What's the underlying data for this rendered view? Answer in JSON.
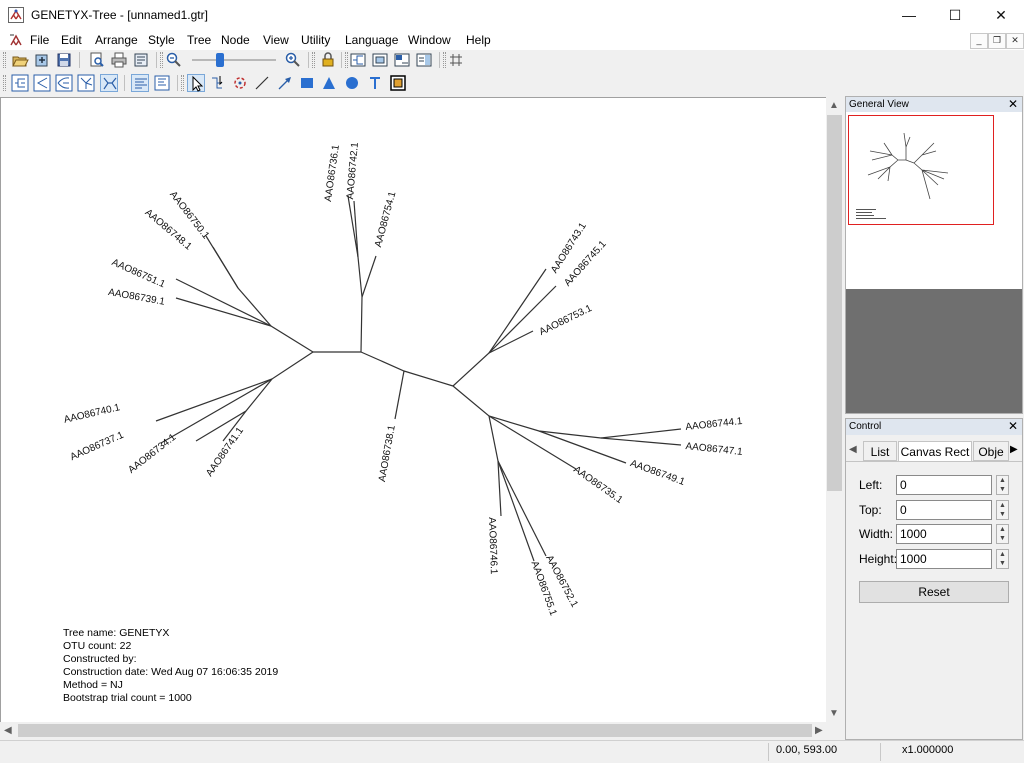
{
  "window": {
    "title": "GENETYX-Tree - [unnamed1.gtr]",
    "controls": {
      "minimize": "—",
      "maximize": "☐",
      "close": "✕"
    }
  },
  "menubar": {
    "items": [
      "File",
      "Edit",
      "Arrange",
      "Style",
      "Tree",
      "Node",
      "View",
      "Utility",
      "Language",
      "Window",
      "Help"
    ],
    "mdi_controls": {
      "minimize": "_",
      "restore": "❐",
      "close": "✕"
    }
  },
  "tree": {
    "leaves": [
      "AAO86736.1",
      "AAO86742.1",
      "AAO86754.1",
      "AAO86750.1",
      "AAO86748.1",
      "AAO86751.1",
      "AAO86739.1",
      "AAO86743.1",
      "AAO86745.1",
      "AAO86753.1",
      "AAO86744.1",
      "AAO86747.1",
      "AAO86749.1",
      "AAO86735.1",
      "AAO86740.1",
      "AAO86737.1",
      "AAO86734.1",
      "AAO86741.1",
      "AAO86738.1",
      "AAO86746.1",
      "AAO86752.1",
      "AAO86755.1"
    ],
    "info": [
      "Tree name: GENETYX",
      "OTU count: 22",
      "Constructed by:",
      "Construction date: Wed Aug 07 16:06:35 2019",
      "Method = NJ",
      "Bootstrap trial count = 1000"
    ]
  },
  "statusbar": {
    "coordinates": "0.00, 593.00",
    "zoom": "x1.000000"
  },
  "general_view": {
    "title": "General View",
    "close": "✕"
  },
  "control": {
    "title": "Control",
    "close": "✕",
    "tabs": [
      "List",
      "Canvas Rect",
      "Obje"
    ],
    "fields": [
      {
        "label": "Left:",
        "value": "0"
      },
      {
        "label": "Top:",
        "value": "0"
      },
      {
        "label": "Width:",
        "value": "1000"
      },
      {
        "label": "Height:",
        "value": "1000"
      }
    ],
    "reset_label": "Reset"
  }
}
